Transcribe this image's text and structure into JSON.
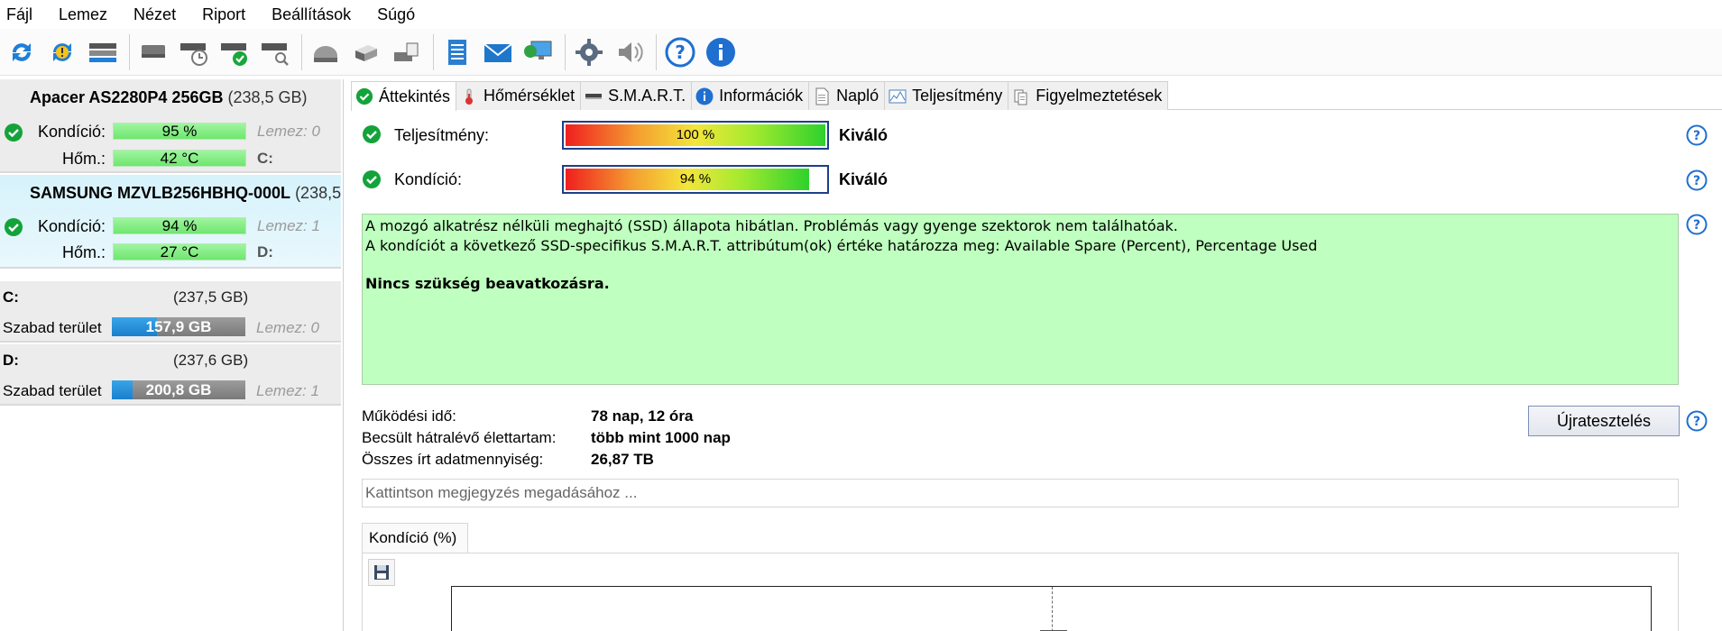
{
  "menubar": {
    "items": [
      {
        "label": "Fájl"
      },
      {
        "label": "Lemez"
      },
      {
        "label": "Nézet"
      },
      {
        "label": "Riport"
      },
      {
        "label": "Beállítások"
      },
      {
        "label": "Súgó"
      }
    ]
  },
  "toolbar": {
    "icons": [
      "refresh-icon",
      "refresh-warning-icon",
      "disk-list-icon",
      "disk-test-icon",
      "disk-schedule-icon",
      "disk-ok-icon",
      "disk-scan-icon",
      "hdd-icon",
      "usb-drive-icon",
      "disk-export-icon",
      "notes-icon",
      "email-icon",
      "network-monitor-icon",
      "settings-gear-icon",
      "speaker-icon",
      "help-icon",
      "info-icon"
    ]
  },
  "sidebar": {
    "disks": [
      {
        "name": "Apacer AS2280P4 256GB",
        "size": "(238,5 GB)",
        "condition_label": "Kondíció:",
        "condition_value": "95 %",
        "temp_label": "Hőm.:",
        "temp_value": "42 °C",
        "disk_index": "Lemez: 0",
        "drive_letter": "C:"
      },
      {
        "name": "SAMSUNG MZVLB256HBHQ-000L",
        "size": "(238,5",
        "condition_label": "Kondíció:",
        "condition_value": "94 %",
        "temp_label": "Hőm.:",
        "temp_value": "27 °C",
        "disk_index": "Lemez: 1",
        "drive_letter": "D:"
      }
    ],
    "volumes": [
      {
        "letter": "C:",
        "size": "(237,5 GB)",
        "free_label": "Szabad terület",
        "free_value": "157,9 GB",
        "used_fraction": 0.335,
        "disk_index": "Lemez: 0"
      },
      {
        "letter": "D:",
        "size": "(237,6 GB)",
        "free_label": "Szabad terület",
        "free_value": "200,8 GB",
        "used_fraction": 0.155,
        "disk_index": "Lemez: 1"
      }
    ]
  },
  "tabs": [
    {
      "label": "Áttekintés",
      "icon": "check-icon",
      "active": true
    },
    {
      "label": "Hőmérséklet",
      "icon": "thermometer-icon",
      "active": false
    },
    {
      "label": "S.M.A.R.T.",
      "icon": "disk-icon",
      "active": false
    },
    {
      "label": "Információk",
      "icon": "info-icon",
      "active": false
    },
    {
      "label": "Napló",
      "icon": "document-icon",
      "active": false
    },
    {
      "label": "Teljesítmény",
      "icon": "chart-icon",
      "active": false
    },
    {
      "label": "Figyelmeztetések",
      "icon": "warnings-icon",
      "active": false
    }
  ],
  "overview": {
    "performance": {
      "label": "Teljesítmény:",
      "percent_text": "100 %",
      "percent": 100,
      "rating": "Kiváló"
    },
    "condition": {
      "label": "Kondíció:",
      "percent_text": "94 %",
      "percent": 94,
      "rating": "Kiváló"
    },
    "status_lines": [
      "A mozgó alkatrész nélküli meghajtó (SSD) állapota hibátlan. Problémás vagy gyenge szektorok nem találhatóak.",
      "A kondíciót a következő SSD-specifikus S.M.A.R.T. attribútum(ok) értéke határozza meg:  Available Spare (Percent), Percentage Used"
    ],
    "status_bold": "Nincs szükség beavatkozásra.",
    "uptime_label": "Működési idő:",
    "uptime_value": "78 nap, 12 óra",
    "remaining_label": "Becsült hátralévő élettartam:",
    "remaining_value": "több mint 1000 nap",
    "written_label": "Összes írt adatmennyiség:",
    "written_value": "26,87 TB",
    "retest_label": "Újratesztelés",
    "note_placeholder": "Kattintson megjegyzés megadásához ...",
    "chart_tab_label": "Kondíció  (%)"
  },
  "colors": {
    "accent_blue": "#1a7fcc",
    "good_green": "#bfffbf",
    "check_green": "#13a33a"
  }
}
